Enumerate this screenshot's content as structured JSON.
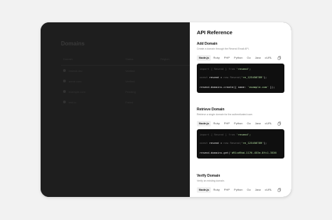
{
  "app": {
    "title": "Domains",
    "columns": [
      "Domain",
      "Status",
      "Region"
    ],
    "rows": [
      {
        "name": "resend.dev",
        "status": "Verified"
      },
      {
        "name": "acme.com",
        "status": "Verified"
      },
      {
        "name": "example.com",
        "status": "Pending"
      },
      {
        "name": "test.io",
        "status": "Failed"
      }
    ]
  },
  "panel": {
    "title": "API Reference",
    "tabs": [
      "Node.js",
      "Ruby",
      "PHP",
      "Python",
      "Go",
      "Java",
      "cURL"
    ],
    "sections": [
      {
        "title": "Add Domain",
        "description": "Create a domain through the Resend Email API.",
        "code": {
          "l1_a": "import",
          "l1_b": " { Resend } ",
          "l1_c": "from",
          "l1_d": " 'resend';",
          "l2_a": "const",
          "l2_b": " resend = ",
          "l2_c": "new",
          "l2_d": " Resend(",
          "l2_e": "'re_123456789'",
          "l2_f": ");",
          "l3_a": "resend.domains.create({ name: ",
          "l3_b": "'example.com'",
          "l3_c": " });"
        }
      },
      {
        "title": "Retrieve Domain",
        "description": "Retrieve a single domain for the authenticated user.",
        "code": {
          "l1_a": "import",
          "l1_b": " { Resend } ",
          "l1_c": "from",
          "l1_d": " 'resend';",
          "l2_a": "const",
          "l2_b": " resend = ",
          "l2_c": "new",
          "l2_d": " Resend(",
          "l2_e": "'re_123456789'",
          "l2_f": ");",
          "l3_a": "resend.domains.get(",
          "l3_b": "'d91cd9bd-1176-453e-8fc1-3536",
          "l3_c": ""
        }
      },
      {
        "title": "Verify Domain",
        "description": "Verify an existing domain."
      }
    ]
  },
  "colors": {
    "backdrop": "#f2f2f2",
    "overlay": "#1e1e1e",
    "code_bg": "#0f0f0f",
    "string": "#b9e6a7"
  }
}
